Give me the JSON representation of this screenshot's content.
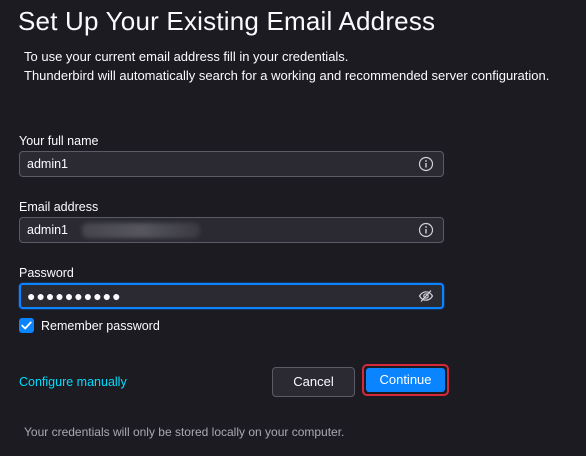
{
  "page": {
    "title": "Set Up Your Existing Email Address",
    "intro_line1": "To use your current email address fill in your credentials.",
    "intro_line2": "Thunderbird will automatically search for a working and recommended server configuration."
  },
  "form": {
    "full_name": {
      "label": "Your full name",
      "value": "admin1",
      "icon": "info-icon"
    },
    "email": {
      "label": "Email address",
      "value": "admin1",
      "icon": "info-icon"
    },
    "password": {
      "label": "Password",
      "value": "●●●●●●●●●●",
      "icon": "eye-slash-icon"
    },
    "remember": {
      "label": "Remember password",
      "checked": true
    }
  },
  "actions": {
    "configure_manually": "Configure manually",
    "cancel": "Cancel",
    "continue": "Continue"
  },
  "footer": {
    "note": "Your credentials will only be stored locally on your computer."
  },
  "colors": {
    "background": "#1c1b22",
    "field_background": "#2b2a33",
    "accent": "#0a84ff",
    "link": "#00ddff",
    "highlight_outline": "#d5293a"
  }
}
